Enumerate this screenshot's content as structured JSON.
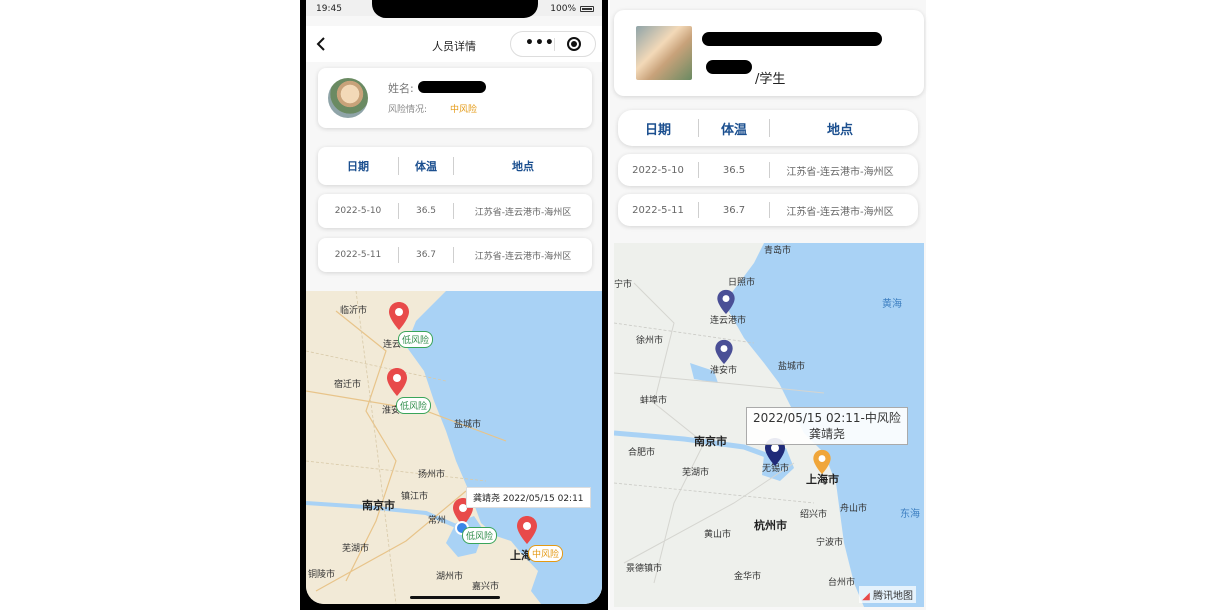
{
  "left": {
    "status": {
      "time": "19:45",
      "battery": "100%"
    },
    "nav": {
      "title": "人员详情"
    },
    "profile": {
      "name_label": "姓名:",
      "risk_label": "风险情况:",
      "risk_value": "中风险"
    },
    "table": {
      "headers": [
        "日期",
        "体温",
        "地点"
      ],
      "rows": [
        {
          "date": "2022-5-10",
          "temp": "36.5",
          "place": "江苏省-连云港市-海州区"
        },
        {
          "date": "2022-5-11",
          "temp": "36.7",
          "place": "江苏省-连云港市-海州区"
        }
      ]
    },
    "map": {
      "cities": [
        "临沂市",
        "连云",
        "宿迁市",
        "淮安",
        "盐城市",
        "扬州市",
        "镇江市",
        "南京市",
        "常州",
        "芜湖市",
        "铜陵市",
        "湖州市",
        "嘉兴市",
        "上海"
      ],
      "tags": [
        "低风险",
        "低风险",
        "低风险",
        "中风险"
      ],
      "tooltip": "龚靖尧 2022/05/15 02:11"
    }
  },
  "right": {
    "profile": {
      "role": "/学生"
    },
    "table": {
      "headers": [
        "日期",
        "体温",
        "地点"
      ],
      "rows": [
        {
          "date": "2022-5-10",
          "temp": "36.5",
          "place": "江苏省-连云港市-海州区"
        },
        {
          "date": "2022-5-11",
          "temp": "36.7",
          "place": "江苏省-连云港市-海州区"
        }
      ]
    },
    "map": {
      "cities": [
        "青岛市",
        "日照市",
        "宁市",
        "连云港市",
        "徐州市",
        "淮安市",
        "盐城市",
        "蚌埠市",
        "南京市",
        "合肥市",
        "芜湖市",
        "无锡市",
        "上海市",
        "杭州市",
        "黄山市",
        "宁波市",
        "舟山市",
        "绍兴市",
        "景德镇市",
        "金华市",
        "台州市"
      ],
      "seas": [
        "黄海",
        "东海"
      ],
      "tooltip_line1": "2022/05/15 02:11-中风险",
      "tooltip_line2": "龚靖尧",
      "credit": "腾讯地图"
    }
  }
}
